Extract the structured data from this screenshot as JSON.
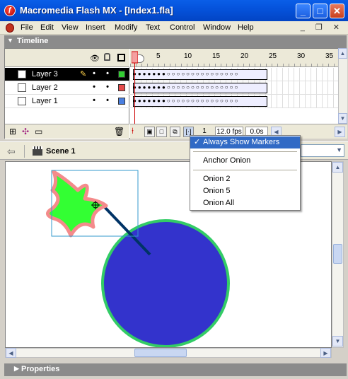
{
  "window": {
    "app_icon": "flash-icon",
    "title": "Macromedia Flash MX - [Index1.fla]",
    "minimize": "_",
    "maximize": "□",
    "close": "✕"
  },
  "menu": [
    "File",
    "Edit",
    "View",
    "Insert",
    "Modify",
    "Text",
    "Control",
    "Window",
    "Help"
  ],
  "doc_window_buttons": "_ ❐ ✕",
  "timeline": {
    "title": "Timeline",
    "ruler": [
      "5",
      "10",
      "15",
      "20",
      "25",
      "30",
      "35"
    ],
    "layers": [
      {
        "name": "Layer 3",
        "color": "#33cc33",
        "selected": true
      },
      {
        "name": "Layer 2",
        "color": "#e64b4b",
        "selected": false
      },
      {
        "name": "Layer 1",
        "color": "#4a7fe0",
        "selected": false
      }
    ],
    "frame_dots": "●●●●●●●○○○○○○○○○○○○○○○",
    "status": {
      "frame": "1",
      "fps": "12.0 fps",
      "time": "0.0s"
    }
  },
  "scene": {
    "label": "Scene 1"
  },
  "properties": {
    "title": "Properties"
  },
  "onion_menu": {
    "check": "✓",
    "items": [
      "Always Show Markers",
      "Anchor Onion",
      "Onion 2",
      "Onion 5",
      "Onion All"
    ]
  },
  "stage_colors": {
    "star_fill": "#33ff33",
    "star_stroke": "#f48b8b",
    "circle_fill": "#3333cc",
    "circle_stroke": "#33cc66",
    "line": "#003366",
    "selection_box": "#3399cc"
  }
}
